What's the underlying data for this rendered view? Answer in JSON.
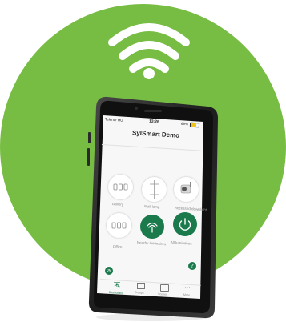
{
  "status_bar": {
    "carrier": "Telenor HU",
    "time": "13:26",
    "battery": "69%"
  },
  "header": {
    "title": "SylSmart Demo"
  },
  "tiles": [
    {
      "label": "Gallery",
      "icon": "light-switch-icon"
    },
    {
      "label": "Wall lamp",
      "icon": "wall-lamp-icon"
    },
    {
      "label": "Recessed downlight",
      "icon": "spotlight-icon"
    },
    {
      "label": "Office",
      "icon": "light-switch-icon"
    },
    {
      "label": "Nearby luminaires",
      "icon": "proximity-icon"
    },
    {
      "label": "All luminaires",
      "icon": "power-icon"
    }
  ],
  "bottom_nav": [
    {
      "label": "Dashboard",
      "icon": "dashboard-icon"
    },
    {
      "label": "Groups",
      "icon": "grid-icon"
    },
    {
      "label": "Scenes",
      "icon": "scene-icon"
    },
    {
      "label": "More",
      "icon": "more-icon"
    }
  ],
  "colors": {
    "brand_green": "#77bd43",
    "accent_teal": "#1b7a4c"
  }
}
